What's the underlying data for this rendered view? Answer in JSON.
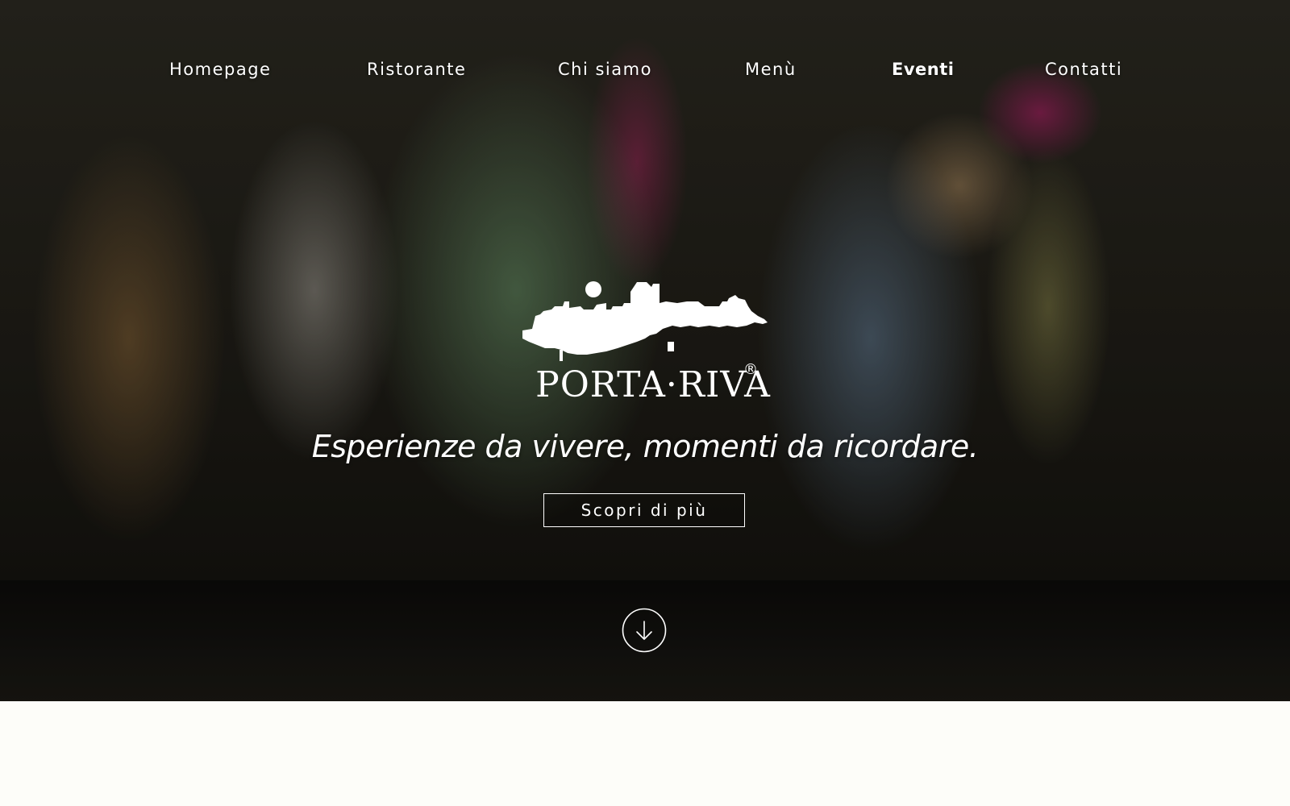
{
  "nav": {
    "items": [
      {
        "label": "Homepage",
        "active": false
      },
      {
        "label": "Ristorante",
        "active": false
      },
      {
        "label": "Chi siamo",
        "active": false
      },
      {
        "label": "Menù",
        "active": false
      },
      {
        "label": "Eventi",
        "active": true
      },
      {
        "label": "Contatti",
        "active": false
      }
    ]
  },
  "brand": {
    "logo_text": "PORTA·RIVA",
    "registered_mark": "®"
  },
  "hero": {
    "tagline": "Esperienze da vivere, momenti da ricordare.",
    "cta_label": "Scopri di più",
    "scroll_icon": "arrow-down-circle-icon"
  },
  "colors": {
    "text": "#ffffff",
    "page_background": "#fdfdf9",
    "hero_dark": "#1e1c16"
  }
}
